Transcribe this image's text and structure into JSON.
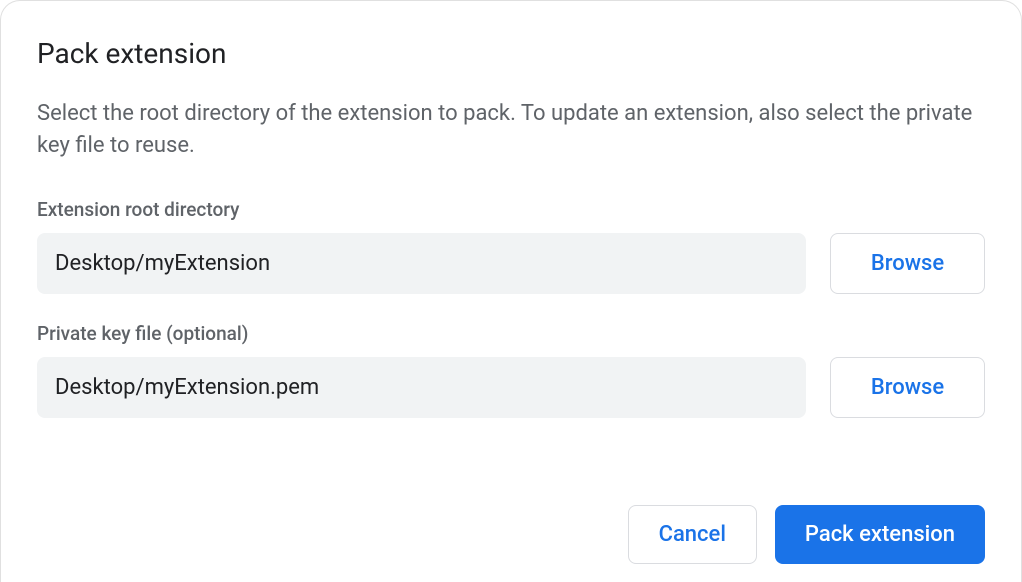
{
  "dialog": {
    "title": "Pack extension",
    "description": "Select the root directory of the extension to pack. To update an extension, also select the private key file to reuse."
  },
  "fields": {
    "root_dir": {
      "label": "Extension root directory",
      "value": "Desktop/myExtension",
      "browse_label": "Browse"
    },
    "private_key": {
      "label": "Private key file (optional)",
      "value": "Desktop/myExtension.pem",
      "browse_label": "Browse"
    }
  },
  "footer": {
    "cancel_label": "Cancel",
    "primary_label": "Pack extension"
  }
}
